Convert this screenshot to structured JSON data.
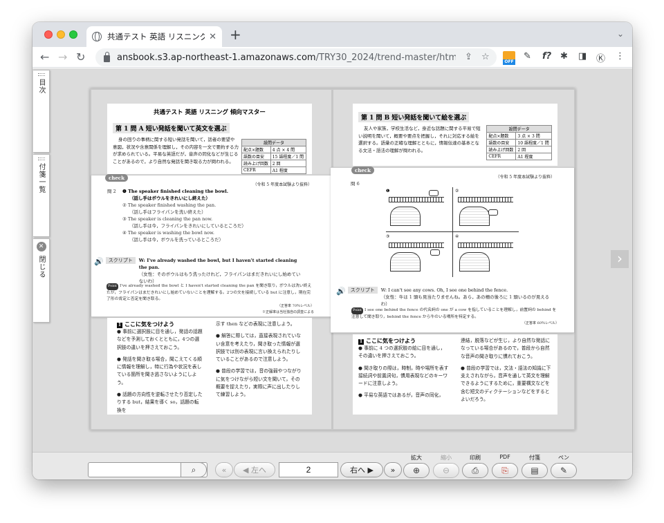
{
  "browser": {
    "tab_title": "共通テスト 英語 リスニング 傾向マ",
    "url_host": "ansbook.s3.ap-northeast-1.amazonaws.com",
    "url_path": "/TRY30_2024/trend-master/html5.html#page...",
    "ext_off_label": "OFF",
    "ext_f_label": "f?"
  },
  "sidebar": {
    "contents_label": "目次",
    "notes_label": "付箋一覧",
    "close_label": "閉じる"
  },
  "left_page": {
    "doc_title": "共通テスト 英語 リスニング 傾向マスター",
    "section_title": "第 1 問 A 短い発話を聞いて英文を選ぶ",
    "intro": "身の回りの事柄に関する短い発話を聞いて，話者の要望や意図，状況や含意関係を理解し，その内容を一文で要約する力が求められている。平易な英語だが，音声の同化などが生じることがあるので，より自然な発話を聞き取る力が問われる。",
    "table": {
      "header": "設問データ",
      "rows": [
        [
          "配点×題数",
          "4 点 × 4 問"
        ],
        [
          "語数の目安",
          "15 語程度／1 問"
        ],
        [
          "読み上げ回数",
          "2 回"
        ],
        [
          "CEFR",
          "A1 程度"
        ]
      ]
    },
    "check_label": "check",
    "source": "（令和 5 年度本試験より抜粋）",
    "question_no": "問 2",
    "options": [
      {
        "num": "❶",
        "en": "The speaker finished cleaning the bowl.",
        "ja": "（話し手はボウルをきれいにし終えた）",
        "bold": true
      },
      {
        "num": "②",
        "en": "The speaker finished washing the pan.",
        "ja": "（話し手はフライパンを洗い終えた）",
        "bold": false
      },
      {
        "num": "③",
        "en": "The speaker is cleaning the pan now.",
        "ja": "（話し手は今，フライパンをきれいにしているところだ）",
        "bold": false
      },
      {
        "num": "④",
        "en": "The speaker is washing the bowl now.",
        "ja": "（話し手は今，ボウルを洗っているところだ）",
        "bold": false
      }
    ],
    "script_label": "スクリプト",
    "script_en": "W: I've already washed the bowl, but I haven't started cleaning the pan.",
    "script_ja": "（女性：そのボウルはもう洗ったけれど，フライパンはまだきれいにし始めていないわ）",
    "point_label": "Point",
    "point_text": "I've already washed the bowl と I haven't started cleaning the pan を聞き取り，ボウルは洗い終えたが，フライパンはまだきれいにし始めていないことを理解する。2つの文を接続している but に注意し，現在完了形の肯定と否定を聞き取る。",
    "level_note": "（正答率 70％レベル）",
    "level_note2": "※正解率は当社独自の調査による",
    "tips_title": "ここに気をつけよう",
    "tips_col1": [
      "事前に選択肢に目を通し，発話の話題などを予測しておくとともに，4つの選択肢の違いを押さえておこう。",
      "発話を聞き取る場合，聞こえてくる順に情報を理解し，特に行為や状況を表している箇所を聞き逃さないようにしよう。",
      "話題の方向性を逆転させたり否定したりする but，結果を導く so，話題の転換を"
    ],
    "tips_col2_lead": "示す then などの表現に注意しよう。",
    "tips_col2": [
      "解答に際しては，直接表現されていない含意を考えたり，聞き取った情報が選択肢では別の表現に言い換えられたりしていることがあるので注意しよう。",
      "普段の学習では，音の強弱やつながりに気をつけながら短い文を聞いて，その概要を捉えたり，実際に声に出したりして練習しよう。"
    ]
  },
  "right_page": {
    "section_title": "第 1 問 B 短い発話を聞いて絵を選ぶ",
    "intro": "友人や家族，学校生活など，身近な話題に関する平易で短い説明を聞いて，概要や要点を把握し，それに対応する絵を選択する。語彙の正確な理解とともに，情報伝達の基本となる文法・語法の理解が問われる。",
    "table": {
      "header": "設問データ",
      "rows": [
        [
          "配点×題数",
          "3 点 × 3 問"
        ],
        [
          "語数の目安",
          "10 語程度／1 問"
        ],
        [
          "読み上げ回数",
          "2 回"
        ],
        [
          "CEFR",
          "A1 程度"
        ]
      ]
    },
    "check_label": "check",
    "source": "（令和 5 年度本試験より抜粋）",
    "question_no": "問 6",
    "image_nums": [
      "❶",
      "②",
      "③",
      "④"
    ],
    "script_label": "スクリプト",
    "script_en": "W: I can't see any cows. Oh, I see one behind the fence.",
    "script_ja": "（女性：牛は 1 頭も見当たりませんね。あら，あの柵の後ろに 1 頭いるのが見えるわ）",
    "point_label": "Point",
    "point_text": "I see one behind the fence の代名詞の one が a cow を指していることを理解し，前置詞の behind を注意して聞き取り，behind the fence から牛のいる場所を特定する。",
    "level_note": "（正答率 60％レベル）",
    "tips_title": "ここに気をつけよう",
    "tips_col1": [
      "事前に 4 つの選択肢の絵に目を通し，その違いを押さえておこう。",
      "聞き取りの際は，時制，時や場所を表す接続詞や前置詞句，慣用表現などのキーワードに注意しよう。",
      "平易な英語ではあるが，音声の同化，"
    ],
    "tips_col2_lead": "連結，脱落などが生じ，より自然な発話になっている場合があるので，普段から自然な音声の聞き取りに慣れておこう。",
    "tips_col2": [
      "普段の学習では，文法・語法の知識に下支えされながら，音声を通して英文を理解できるようにするために，重要構文などを含む短文のディクテーションなどをするとよいだろう。"
    ]
  },
  "bottom": {
    "search_value": "",
    "prev_label": "左へ",
    "page_value": "2",
    "next_label": "右へ",
    "zoom_in_label": "拡大",
    "zoom_out_label": "縮小",
    "print_label": "印刷",
    "pdf_label": "PDF",
    "sticky_label": "付箋",
    "pen_label": "ペン"
  }
}
